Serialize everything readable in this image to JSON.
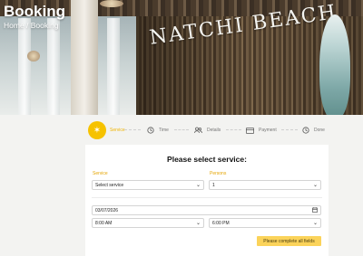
{
  "hero": {
    "title": "Booking",
    "breadcrumb": "Home / Booking",
    "sign_text": "NATCHI BEACH"
  },
  "steps": [
    {
      "label": "Service",
      "icon": "sparkle-icon",
      "active": true
    },
    {
      "label": "Time",
      "icon": "clock-icon",
      "active": false
    },
    {
      "label": "Details",
      "icon": "users-icon",
      "active": false
    },
    {
      "label": "Payment",
      "icon": "credit-card-icon",
      "active": false
    },
    {
      "label": "Done",
      "icon": "clock-icon",
      "active": false
    }
  ],
  "form": {
    "heading": "Please select service:",
    "service_label": "Service",
    "service_value": "Select service",
    "persons_label": "Persons",
    "persons_value": "1",
    "date_value": "03/07/2026",
    "start_time": "8:00 AM",
    "end_time": "6:00 PM",
    "submit_label": "Please complete all fields"
  },
  "colors": {
    "accent": "#f6c200",
    "label": "#e5a400",
    "button": "#fbd35a"
  }
}
